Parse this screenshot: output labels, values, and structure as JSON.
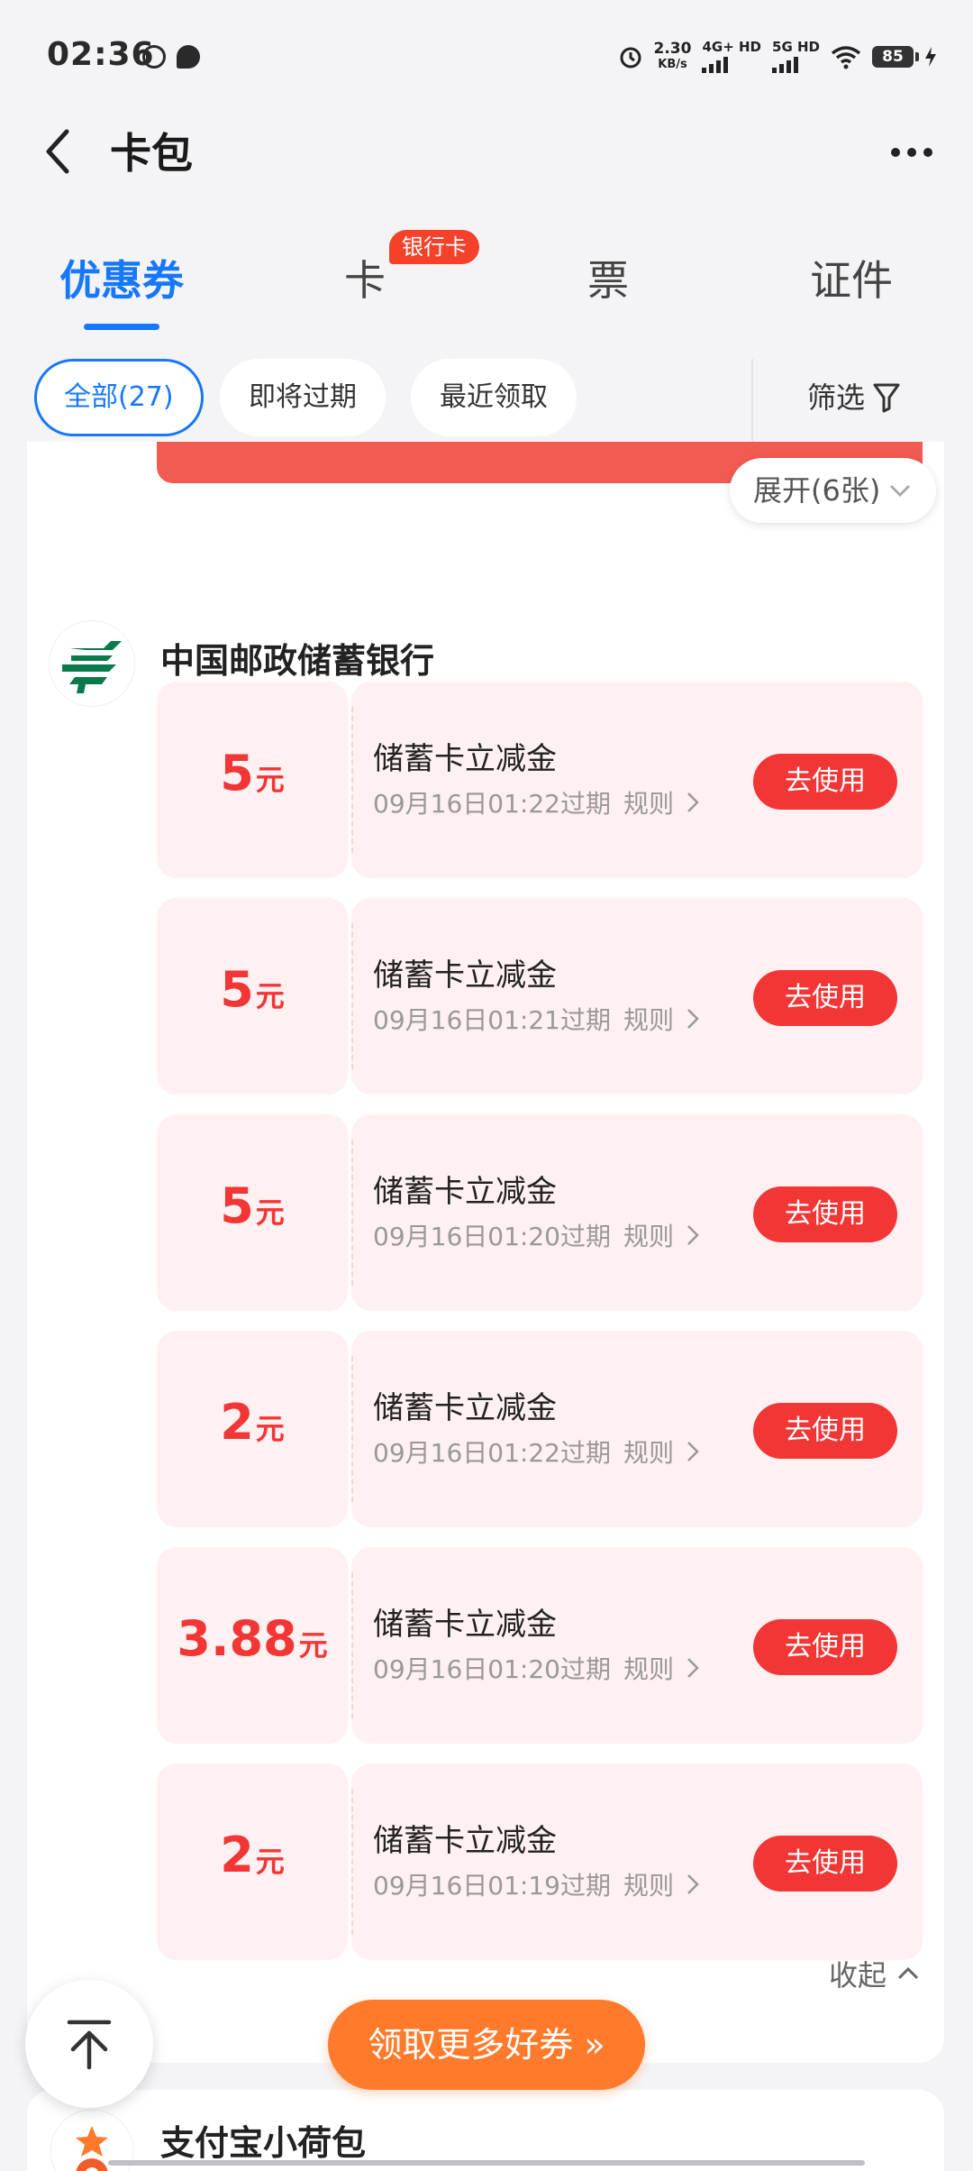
{
  "status_bar": {
    "time": "02:36",
    "speed_value": "2.30",
    "speed_unit": "KB/s",
    "net1": "4G+ HD",
    "net2": "5G HD",
    "battery": "85"
  },
  "header": {
    "title": "卡包"
  },
  "tabs": [
    {
      "label": "优惠券"
    },
    {
      "label": "卡"
    },
    {
      "label": "票"
    },
    {
      "label": "证件"
    }
  ],
  "tab_badge": "银行卡",
  "filters": {
    "all": "全部(27)",
    "expiring": "即将过期",
    "recent": "最近领取",
    "filter": "筛选"
  },
  "expand_label": "展开(6张)",
  "bank": {
    "name": "中国邮政储蓄银行",
    "coupons": [
      {
        "amount": "5",
        "unit": "元",
        "title": "储蓄卡立减金",
        "expire": "09月16日01:22过期",
        "rule": "规则",
        "button": "去使用"
      },
      {
        "amount": "5",
        "unit": "元",
        "title": "储蓄卡立减金",
        "expire": "09月16日01:21过期",
        "rule": "规则",
        "button": "去使用"
      },
      {
        "amount": "5",
        "unit": "元",
        "title": "储蓄卡立减金",
        "expire": "09月16日01:20过期",
        "rule": "规则",
        "button": "去使用"
      },
      {
        "amount": "2",
        "unit": "元",
        "title": "储蓄卡立减金",
        "expire": "09月16日01:22过期",
        "rule": "规则",
        "button": "去使用"
      },
      {
        "amount": "3.88",
        "unit": "元",
        "title": "储蓄卡立减金",
        "expire": "09月16日01:20过期",
        "rule": "规则",
        "button": "去使用"
      },
      {
        "amount": "2",
        "unit": "元",
        "title": "储蓄卡立减金",
        "expire": "09月16日01:19过期",
        "rule": "规则",
        "button": "去使用"
      }
    ]
  },
  "collapse_label": "收起",
  "next_card": {
    "name": "支付宝小荷包"
  },
  "more_coupons": "领取更多好券 »",
  "colors": {
    "accent": "#1677ff",
    "coupon_red": "#f23535",
    "orange": "#ff7a2a"
  }
}
